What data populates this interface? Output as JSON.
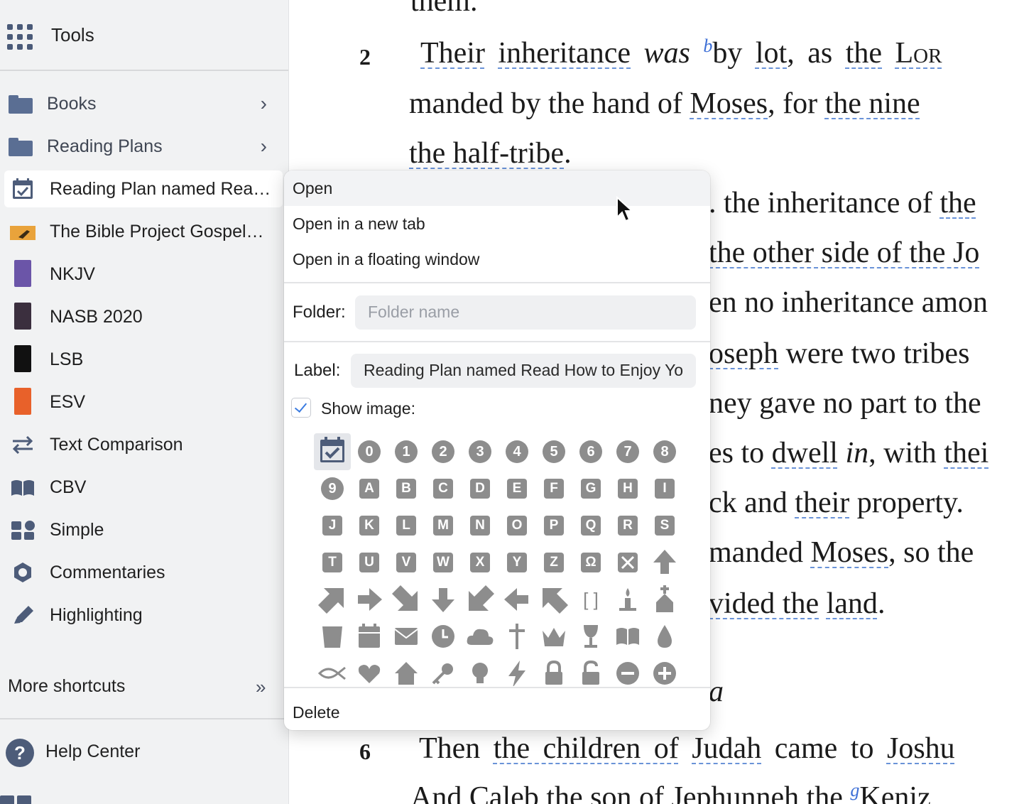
{
  "sidebar": {
    "tools_label": "Tools",
    "items": [
      {
        "label": "Books",
        "icon": "folder-icon"
      },
      {
        "label": "Reading Plans",
        "icon": "folder-icon"
      },
      {
        "label": "Reading Plan named Rea…",
        "icon": "calendar-check-icon"
      },
      {
        "label": "The Bible Project Gospel…",
        "icon": "book-cover-icon"
      },
      {
        "label": "NKJV",
        "icon": "book-cover-icon"
      },
      {
        "label": "NASB 2020",
        "icon": "book-cover-icon"
      },
      {
        "label": "LSB",
        "icon": "book-cover-icon"
      },
      {
        "label": "ESV",
        "icon": "book-cover-icon"
      },
      {
        "label": "Text Comparison",
        "icon": "arrows-swap-icon"
      },
      {
        "label": "CBV",
        "icon": "open-book-icon"
      },
      {
        "label": "Simple",
        "icon": "layout-icon"
      },
      {
        "label": "Commentaries",
        "icon": "hexagon-icon"
      },
      {
        "label": "Highlighting",
        "icon": "pencil-icon"
      }
    ],
    "more_shortcuts": "More shortcuts",
    "help_center": "Help Center"
  },
  "context_menu": {
    "open": "Open",
    "open_new_tab": "Open in a new tab",
    "open_floating": "Open in a floating window",
    "folder_label": "Folder:",
    "folder_placeholder": "Folder name",
    "label_label": "Label:",
    "label_value": "Reading Plan named Read How to Enjoy Yo",
    "show_image_label": "Show image:",
    "show_image_checked": true,
    "delete": "Delete",
    "icon_grid": {
      "row1": [
        "calendar-check",
        "0",
        "1",
        "2",
        "3",
        "4",
        "5",
        "6",
        "7",
        "8"
      ],
      "row2": [
        "9",
        "A",
        "B",
        "C",
        "D",
        "E",
        "F",
        "G",
        "H",
        "I"
      ],
      "row3": [
        "J",
        "K",
        "L",
        "M",
        "N",
        "O",
        "P",
        "Q",
        "R",
        "S"
      ],
      "row4": [
        "T",
        "U",
        "V",
        "W",
        "X",
        "Y",
        "Z",
        "Ω",
        "no-symbol",
        "arrow-up"
      ],
      "row5": [
        "arrow-up-right",
        "arrow-right",
        "arrow-down-right",
        "arrow-down",
        "arrow-down-left",
        "arrow-left",
        "arrow-up-left",
        "brackets",
        "candle",
        "church"
      ],
      "row6": [
        "trash-can",
        "calendar",
        "envelope",
        "clock",
        "cloud",
        "cross",
        "crown",
        "chalice",
        "open-book",
        "droplet"
      ],
      "row7": [
        "fish",
        "heart",
        "house",
        "key",
        "lightbulb",
        "lightning",
        "lock",
        "unlock",
        "minus-circle",
        "plus-circle"
      ]
    }
  },
  "reader": {
    "line_them": "them.",
    "v2_num": "2",
    "v2_a": "Their",
    "v2_b": "inheritance",
    "v2_was": "was",
    "v2_fn": "b",
    "v2_c": "by",
    "v2_d": "lot",
    "v2_e": ", as",
    "v2_f": "the",
    "v2_lord": "Lor",
    "l2_a": "manded by the hand of",
    "l2_moses": "Moses",
    "l2_b": ", for",
    "l2_c": "the nine",
    "l3_a": "the half-tribe",
    "l3_b": ".",
    "l4": ". the inheritance of",
    "l4_the": "the",
    "l5": "the other side of the Jo",
    "l6": "en no inheritance amon",
    "l7_a": "oseph",
    "l7_b": "were two tribes",
    "l8": "ney gave no part to the",
    "l9_a": "es to",
    "l9_b": "dwell",
    "l9_in": "in",
    "l9_c": ", with",
    "l9_d": "thei",
    "l10_a": "ck and",
    "l10_b": "their",
    "l10_c": "property.",
    "l11_a": "manded",
    "l11_b": "Moses",
    "l11_c": ", so the",
    "l12_a": "vided the",
    "l12_b": "land",
    "l12_c": ".",
    "l13": "a",
    "v6_num": "6",
    "v6_a": "Then",
    "v6_b": "the children of",
    "v6_c": "Judah",
    "v6_d": "came to",
    "v6_e": "Joshu",
    "l15_a": "And",
    "l15_b": "Caleb",
    "l15_c": "the son of",
    "l15_d": "Jephunneh",
    "l15_e": "the",
    "l15_fn": "g",
    "l15_f": "Keniz"
  },
  "colors": {
    "sidebar_bg": "#f1f2f3",
    "icon_blue": "#4d5c79",
    "footnote_blue": "#3d6fd6",
    "grid_icon_gray": "#8d8d8d",
    "checkbox_accent": "#3a7be0"
  }
}
